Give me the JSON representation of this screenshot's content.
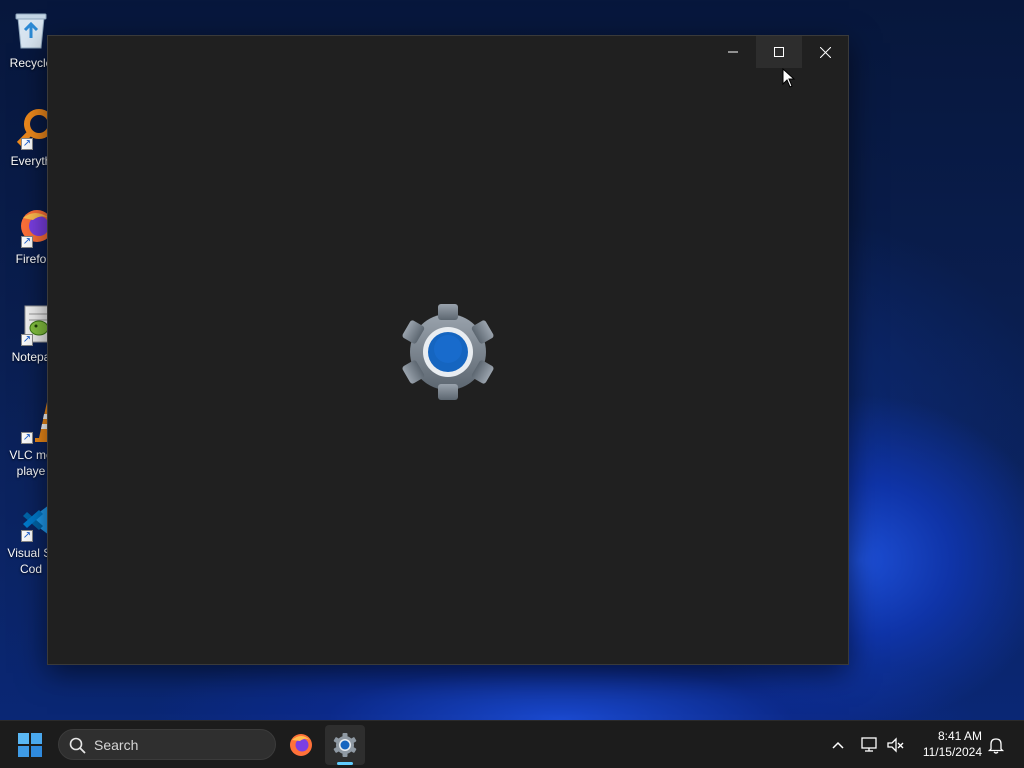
{
  "desktop": {
    "icons": [
      {
        "label": "Recycle",
        "icon": "recycle-bin-icon"
      },
      {
        "label": "Everyth",
        "icon": "everything-search-icon"
      },
      {
        "label": "Firefo",
        "icon": "firefox-icon"
      },
      {
        "label": "Notepa",
        "icon": "notepad-plus-plus-icon"
      },
      {
        "label": "VLC me\nplaye",
        "icon": "vlc-cone-icon"
      },
      {
        "label": "Visual St\nCod",
        "icon": "vscode-icon"
      }
    ]
  },
  "window": {
    "app": "Settings",
    "state": "loading splash",
    "controls": [
      "minimize",
      "maximize",
      "close"
    ],
    "splash_icon": "settings-gear-icon"
  },
  "taskbar": {
    "search_placeholder": "Search",
    "pinned": [
      {
        "name": "Firefox",
        "icon": "firefox-icon"
      },
      {
        "name": "Settings",
        "icon": "settings-gear-icon",
        "active": true
      }
    ],
    "tray": {
      "time": "8:41 AM",
      "date": "11/15/2024"
    }
  },
  "colors": {
    "window_bg": "#202020",
    "taskbar_bg": "#1c1c1c",
    "accent": "#60cdff",
    "gear_blue": "#1565c0"
  }
}
